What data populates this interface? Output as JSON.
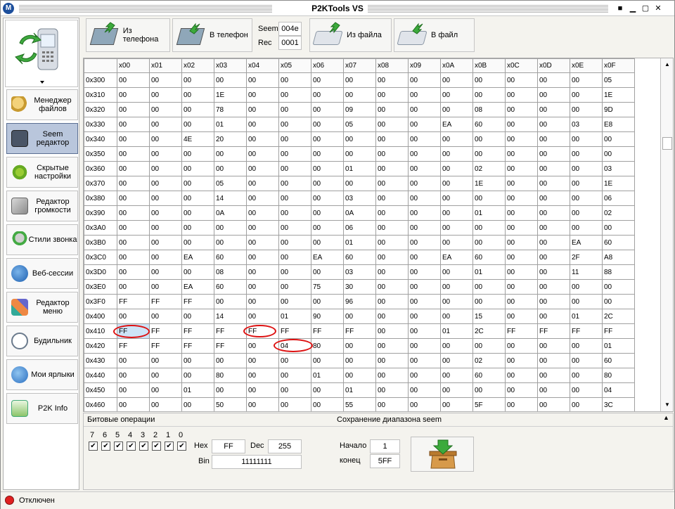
{
  "window": {
    "title": "P2KTools VS",
    "logo": "M"
  },
  "sidebar": {
    "items": [
      {
        "label": "Менеджер файлов",
        "icon": "file-manager-icon"
      },
      {
        "label": "Seem редактор",
        "icon": "seem-editor-icon",
        "active": true
      },
      {
        "label": "Скрытые настройки",
        "icon": "hidden-settings-icon"
      },
      {
        "label": "Редактор громкости",
        "icon": "volume-editor-icon"
      },
      {
        "label": "Стили звонка",
        "icon": "ring-styles-icon"
      },
      {
        "label": "Веб-сессии",
        "icon": "web-sessions-icon"
      },
      {
        "label": "Редактор меню",
        "icon": "menu-editor-icon"
      },
      {
        "label": "Будильник",
        "icon": "alarm-clock-icon"
      },
      {
        "label": "Мои ярлыки",
        "icon": "my-shortcuts-icon"
      },
      {
        "label": "P2K Info",
        "icon": "p2k-info-icon"
      }
    ]
  },
  "toolbar": {
    "from_phone": "Из телефона",
    "to_phone": "В телефон",
    "seem_label": "Seem",
    "seem_value": "004e",
    "rec_label": "Rec",
    "rec_value": "0001",
    "from_file": "Из файла",
    "to_file": "В файл"
  },
  "grid": {
    "columns": [
      "x00",
      "x01",
      "x02",
      "x03",
      "x04",
      "x05",
      "x06",
      "x07",
      "x08",
      "x09",
      "x0A",
      "x0B",
      "x0C",
      "x0D",
      "x0E",
      "x0F"
    ],
    "rows": [
      {
        "addr": "0x300",
        "cells": [
          "00",
          "00",
          "00",
          "00",
          "00",
          "00",
          "00",
          "00",
          "00",
          "00",
          "00",
          "00",
          "00",
          "00",
          "00",
          "05"
        ]
      },
      {
        "addr": "0x310",
        "cells": [
          "00",
          "00",
          "00",
          "1E",
          "00",
          "00",
          "00",
          "00",
          "00",
          "00",
          "00",
          "00",
          "00",
          "00",
          "00",
          "1E"
        ]
      },
      {
        "addr": "0x320",
        "cells": [
          "00",
          "00",
          "00",
          "78",
          "00",
          "00",
          "00",
          "09",
          "00",
          "00",
          "00",
          "08",
          "00",
          "00",
          "00",
          "9D"
        ]
      },
      {
        "addr": "0x330",
        "cells": [
          "00",
          "00",
          "00",
          "01",
          "00",
          "00",
          "00",
          "05",
          "00",
          "00",
          "EA",
          "60",
          "00",
          "00",
          "03",
          "E8"
        ]
      },
      {
        "addr": "0x340",
        "cells": [
          "00",
          "00",
          "4E",
          "20",
          "00",
          "00",
          "00",
          "00",
          "00",
          "00",
          "00",
          "00",
          "00",
          "00",
          "00",
          "00"
        ]
      },
      {
        "addr": "0x350",
        "cells": [
          "00",
          "00",
          "00",
          "00",
          "00",
          "00",
          "00",
          "00",
          "00",
          "00",
          "00",
          "00",
          "00",
          "00",
          "00",
          "00"
        ]
      },
      {
        "addr": "0x360",
        "cells": [
          "00",
          "00",
          "00",
          "00",
          "00",
          "00",
          "00",
          "01",
          "00",
          "00",
          "00",
          "02",
          "00",
          "00",
          "00",
          "03"
        ]
      },
      {
        "addr": "0x370",
        "cells": [
          "00",
          "00",
          "00",
          "05",
          "00",
          "00",
          "00",
          "00",
          "00",
          "00",
          "00",
          "1E",
          "00",
          "00",
          "00",
          "1E"
        ]
      },
      {
        "addr": "0x380",
        "cells": [
          "00",
          "00",
          "00",
          "14",
          "00",
          "00",
          "00",
          "03",
          "00",
          "00",
          "00",
          "00",
          "00",
          "00",
          "00",
          "06"
        ]
      },
      {
        "addr": "0x390",
        "cells": [
          "00",
          "00",
          "00",
          "0A",
          "00",
          "00",
          "00",
          "0A",
          "00",
          "00",
          "00",
          "01",
          "00",
          "00",
          "00",
          "02"
        ]
      },
      {
        "addr": "0x3A0",
        "cells": [
          "00",
          "00",
          "00",
          "00",
          "00",
          "00",
          "00",
          "06",
          "00",
          "00",
          "00",
          "00",
          "00",
          "00",
          "00",
          "00"
        ]
      },
      {
        "addr": "0x3B0",
        "cells": [
          "00",
          "00",
          "00",
          "00",
          "00",
          "00",
          "00",
          "01",
          "00",
          "00",
          "00",
          "00",
          "00",
          "00",
          "EA",
          "60"
        ]
      },
      {
        "addr": "0x3C0",
        "cells": [
          "00",
          "00",
          "EA",
          "60",
          "00",
          "00",
          "EA",
          "60",
          "00",
          "00",
          "EA",
          "60",
          "00",
          "00",
          "2F",
          "A8"
        ]
      },
      {
        "addr": "0x3D0",
        "cells": [
          "00",
          "00",
          "00",
          "08",
          "00",
          "00",
          "00",
          "03",
          "00",
          "00",
          "00",
          "01",
          "00",
          "00",
          "11",
          "88"
        ]
      },
      {
        "addr": "0x3E0",
        "cells": [
          "00",
          "00",
          "EA",
          "60",
          "00",
          "00",
          "75",
          "30",
          "00",
          "00",
          "00",
          "00",
          "00",
          "00",
          "00",
          "00"
        ]
      },
      {
        "addr": "0x3F0",
        "cells": [
          "FF",
          "FF",
          "FF",
          "00",
          "00",
          "00",
          "00",
          "96",
          "00",
          "00",
          "00",
          "00",
          "00",
          "00",
          "00",
          "00"
        ]
      },
      {
        "addr": "0x400",
        "cells": [
          "00",
          "00",
          "00",
          "14",
          "00",
          "01",
          "90",
          "00",
          "00",
          "00",
          "00",
          "15",
          "00",
          "00",
          "01",
          "2C"
        ]
      },
      {
        "addr": "0x410",
        "cells": [
          "FF",
          "FF",
          "FF",
          "FF",
          "FF",
          "FF",
          "FF",
          "FF",
          "00",
          "00",
          "01",
          "2C",
          "FF",
          "FF",
          "FF",
          "FF"
        ]
      },
      {
        "addr": "0x420",
        "cells": [
          "FF",
          "FF",
          "FF",
          "FF",
          "00",
          "04",
          "80",
          "00",
          "00",
          "00",
          "00",
          "00",
          "00",
          "00",
          "00",
          "01"
        ]
      },
      {
        "addr": "0x430",
        "cells": [
          "00",
          "00",
          "00",
          "00",
          "00",
          "00",
          "00",
          "00",
          "00",
          "00",
          "00",
          "02",
          "00",
          "00",
          "00",
          "60"
        ]
      },
      {
        "addr": "0x440",
        "cells": [
          "00",
          "00",
          "00",
          "80",
          "00",
          "00",
          "01",
          "00",
          "00",
          "00",
          "00",
          "60",
          "00",
          "00",
          "00",
          "80"
        ]
      },
      {
        "addr": "0x450",
        "cells": [
          "00",
          "00",
          "01",
          "00",
          "00",
          "00",
          "00",
          "01",
          "00",
          "00",
          "00",
          "00",
          "00",
          "00",
          "00",
          "04"
        ]
      },
      {
        "addr": "0x460",
        "cells": [
          "00",
          "00",
          "00",
          "50",
          "00",
          "00",
          "00",
          "55",
          "00",
          "00",
          "00",
          "5F",
          "00",
          "00",
          "00",
          "3C"
        ]
      }
    ]
  },
  "bitops": {
    "title": "Битовые операции",
    "bits": [
      "7",
      "6",
      "5",
      "4",
      "3",
      "2",
      "1",
      "0"
    ],
    "checked": [
      true,
      true,
      true,
      true,
      true,
      true,
      true,
      true
    ],
    "hex_label": "Hex",
    "hex_value": "FF",
    "dec_label": "Dec",
    "dec_value": "255",
    "bin_label": "Bin",
    "bin_value": "11111111"
  },
  "range_save": {
    "title": "Сохранение диапазона seem",
    "start_label": "Начало",
    "start_value": "1",
    "end_label": "конец",
    "end_value": "5FF"
  },
  "status": {
    "text": "Отключен",
    "color": "#e02020"
  }
}
